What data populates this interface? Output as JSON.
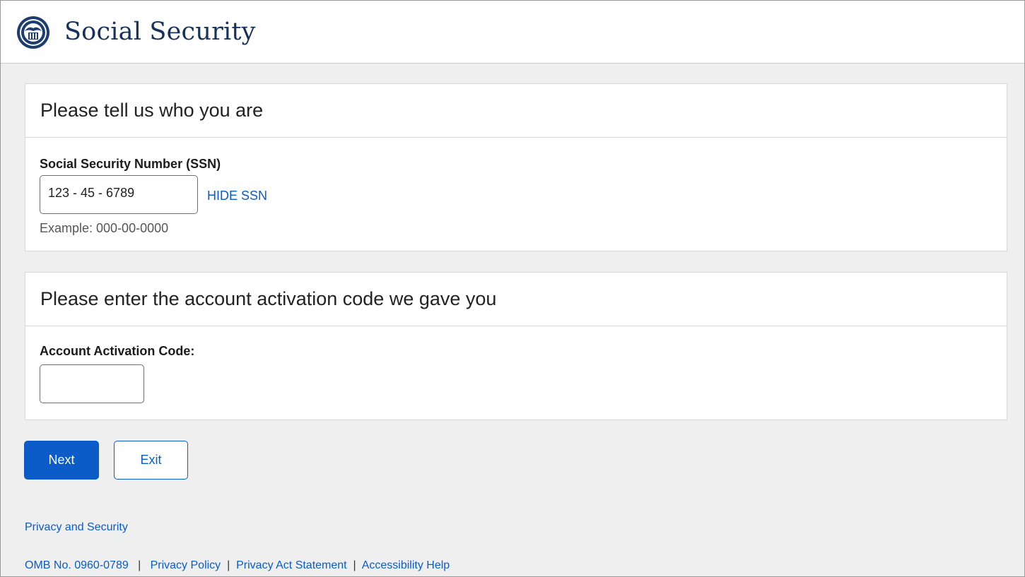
{
  "header": {
    "logo_icon": "ssa-seal-icon",
    "brand": "Social Security"
  },
  "ssn_section": {
    "title": "Please tell us who you are",
    "label": "Social Security Number (SSN)",
    "value": "123 - 45 - 6789",
    "toggle_link": "HIDE SSN",
    "example": "Example: 000-00-0000"
  },
  "activation_section": {
    "title": "Please enter the account activation code we gave you",
    "label": "Account Activation Code:",
    "value": ""
  },
  "actions": {
    "next_label": "Next",
    "exit_label": "Exit"
  },
  "footer": {
    "privacy_security": "Privacy and Security",
    "omb": "OMB No. 0960-0789",
    "separator": "|",
    "privacy_policy": "Privacy Policy",
    "privacy_act": "Privacy Act Statement",
    "accessibility": "Accessibility Help"
  },
  "colors": {
    "brand_navy": "#16325c",
    "link_blue": "#0b5cc9",
    "page_bg": "#efefef"
  }
}
